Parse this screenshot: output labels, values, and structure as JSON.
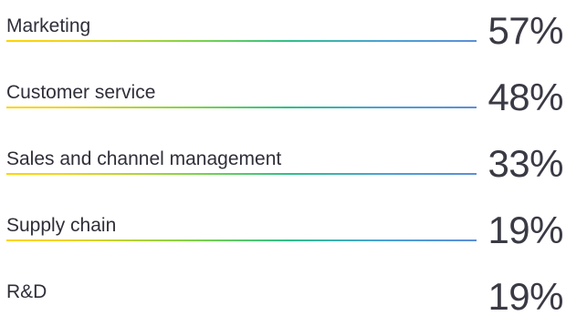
{
  "chart_data": {
    "type": "bar",
    "categories": [
      "Marketing",
      "Customer service",
      "Sales and channel management",
      "Supply chain",
      "R&D"
    ],
    "values": [
      57,
      48,
      33,
      19,
      19
    ],
    "value_labels": [
      "57%",
      "48%",
      "33%",
      "19%",
      "19%"
    ],
    "colors": {
      "gradient_start": "#ffd400",
      "gradient_mid": "#2fc08a",
      "gradient_end": "#5b8fd8"
    }
  }
}
